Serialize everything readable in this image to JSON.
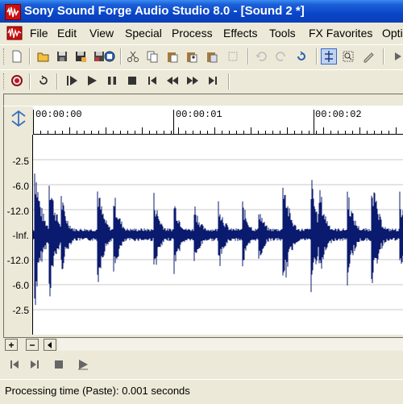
{
  "window": {
    "title": "Sony Sound Forge Audio Studio 8.0 - [Sound 2 *]"
  },
  "menu": {
    "items": [
      {
        "label": "File"
      },
      {
        "label": "Edit"
      },
      {
        "label": "View"
      },
      {
        "label": "Special"
      },
      {
        "label": "Process"
      },
      {
        "label": "Effects"
      },
      {
        "label": "Tools"
      },
      {
        "label": "FX Favorites"
      },
      {
        "label": "Opti"
      }
    ]
  },
  "toolbar": {
    "icons": [
      "new-icon",
      "open-icon",
      "save-icon",
      "save-as-icon",
      "render-icon",
      "cut-icon",
      "copy-icon",
      "paste-icon",
      "paste-special-icon",
      "mix-icon",
      "crop-icon",
      "undo-icon",
      "redo-icon",
      "repeat-icon",
      "edit-tool-icon",
      "magnify-tool-icon",
      "pencil-tool-icon",
      "event-tool-icon"
    ]
  },
  "transport": {
    "icons": [
      "record-icon",
      "loop-icon",
      "play-all-icon",
      "play-icon",
      "pause-icon",
      "stop-icon",
      "go-to-start-icon",
      "rewind-icon",
      "fast-forward-icon",
      "go-to-end-icon"
    ]
  },
  "ruler": {
    "labels": [
      "00:00:00",
      "00:00:01",
      "00:00:02"
    ]
  },
  "db_scale": {
    "labels": [
      "-2.5",
      "-6.0",
      "-12.0",
      "-Inf.",
      "-12.0",
      "-6.0",
      "-2.5"
    ]
  },
  "scroll": {
    "zoom_in_label": "+",
    "zoom_out_label": "−"
  },
  "status": {
    "text": "Processing time (Paste): 0.001 seconds"
  },
  "colors": {
    "title_bar": "#0a46c8",
    "waveform": "#0a1a6e",
    "background": "#ece9d8"
  }
}
